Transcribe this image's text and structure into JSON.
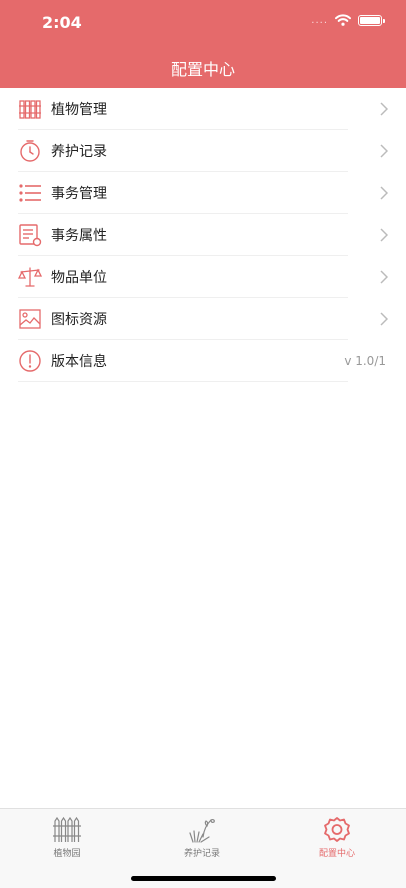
{
  "status_bar": {
    "time": "2:04",
    "signal": "....",
    "wifi_icon": "wifi-icon",
    "battery_icon": "battery-icon"
  },
  "nav": {
    "title": "配置中心"
  },
  "theme": {
    "accent": "#E56A6B",
    "icon_color": "#E56A6B",
    "text": "#222222",
    "secondary": "#999999"
  },
  "menu": {
    "items": [
      {
        "label": "植物管理",
        "icon": "fence-icon",
        "chevron": true
      },
      {
        "label": "养护记录",
        "icon": "timer-icon",
        "chevron": true
      },
      {
        "label": "事务管理",
        "icon": "list-icon",
        "chevron": true
      },
      {
        "label": "事务属性",
        "icon": "document-icon",
        "chevron": true
      },
      {
        "label": "物品单位",
        "icon": "scale-icon",
        "chevron": true
      },
      {
        "label": "图标资源",
        "icon": "image-icon",
        "chevron": true
      },
      {
        "label": "版本信息",
        "icon": "info-icon",
        "value": "v 1.0/1"
      }
    ]
  },
  "tabbar": {
    "tabs": [
      {
        "label": "植物园",
        "icon": "fence-icon",
        "active": false
      },
      {
        "label": "养护记录",
        "icon": "plant-icon",
        "active": false
      },
      {
        "label": "配置中心",
        "icon": "gear-icon",
        "active": true
      }
    ]
  }
}
